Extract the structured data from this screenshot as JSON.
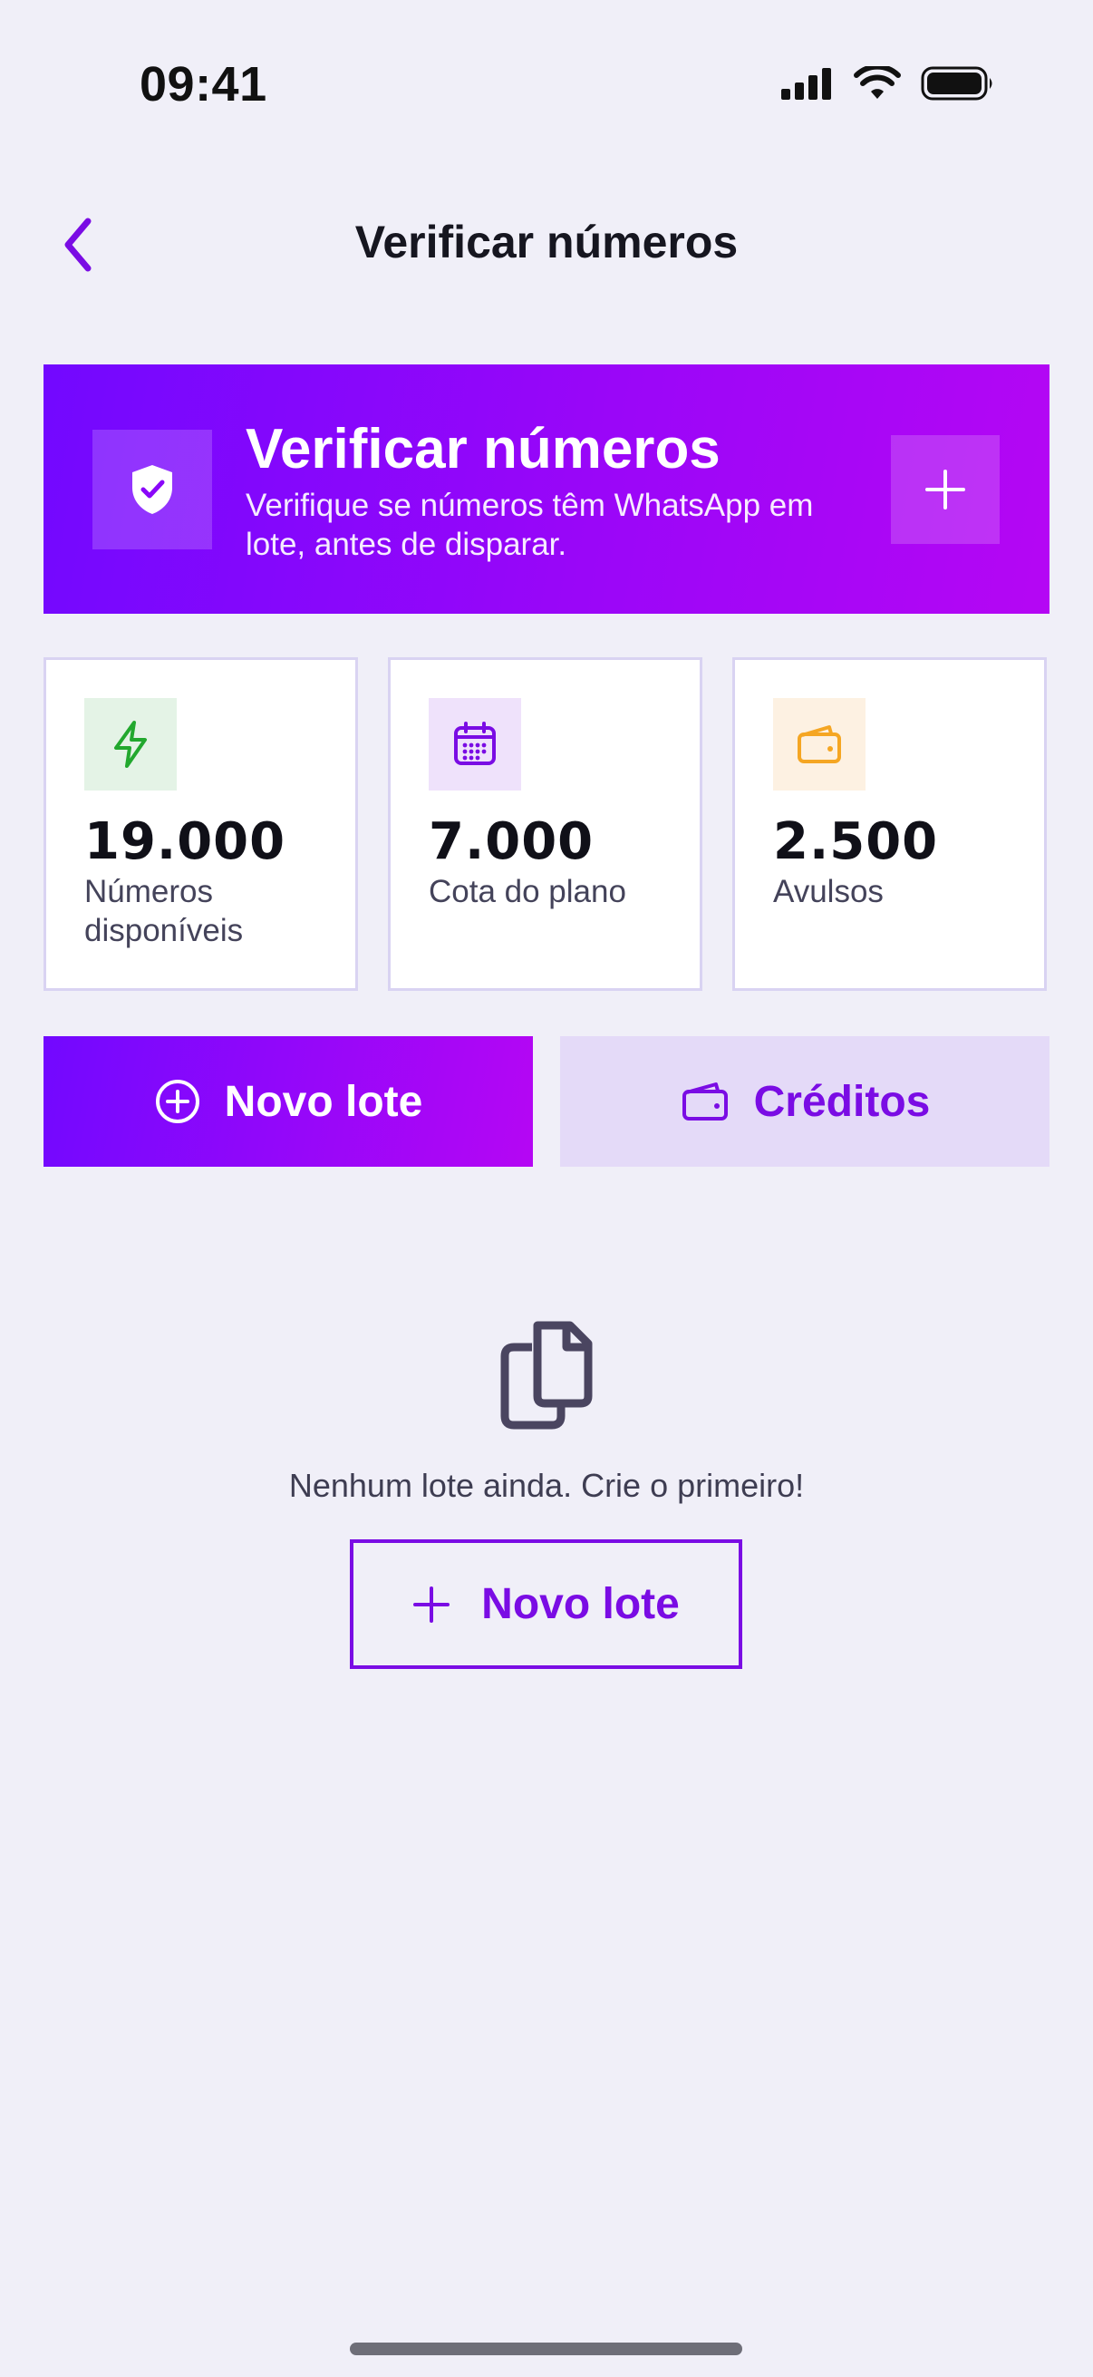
{
  "status_bar": {
    "time": "09:41"
  },
  "nav": {
    "title": "Verificar números",
    "back_icon": "chevron-left-icon"
  },
  "hero": {
    "title": "Verificar números",
    "description": "Verifique se números têm WhatsApp em lote, antes de disparar.",
    "shield_icon": "shield-check-icon",
    "add_icon": "plus-icon"
  },
  "stats": [
    {
      "value": "19.000",
      "label": "Números disponíveis",
      "icon": "lightning-icon",
      "icon_color": "#22A82E",
      "icon_bg": "#E4F3E6"
    },
    {
      "value": "7.000",
      "label": "Cota do plano",
      "icon": "calendar-icon",
      "icon_color": "#7A0CE4",
      "icon_bg": "#EFE2FB"
    },
    {
      "value": "2.500",
      "label": "Avulsos",
      "icon": "wallet-icon",
      "icon_color": "#F5A623",
      "icon_bg": "#FDF1E2"
    }
  ],
  "actions": {
    "new_batch_label": "Novo lote",
    "credits_label": "Créditos"
  },
  "empty_state": {
    "message": "Nenhum lote ainda. Crie o primeiro!",
    "button_label": "Novo lote",
    "icon": "documents-icon"
  },
  "colors": {
    "accent": "#7A0CE4",
    "gradient_start": "#7208FF",
    "gradient_end": "#B506F4",
    "background": "#F0EFF8"
  }
}
